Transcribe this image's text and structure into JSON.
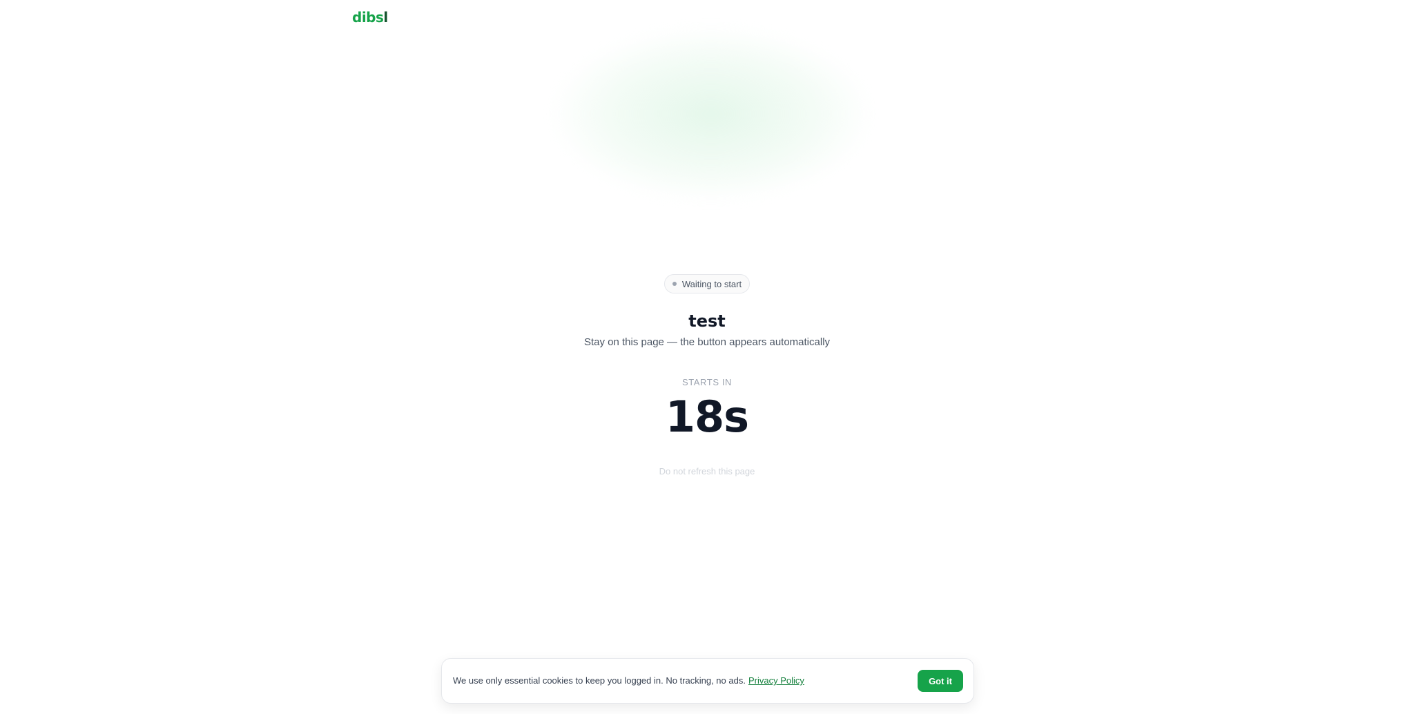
{
  "header": {
    "logo_main": "dibs",
    "logo_tail": "l"
  },
  "status": {
    "label": "Waiting to start"
  },
  "event": {
    "title": "test",
    "subtitle": "Stay on this page — the button appears automatically"
  },
  "countdown": {
    "label": "STARTS IN",
    "value": "18s",
    "note": "Do not refresh this page"
  },
  "cookie_banner": {
    "text": "We use only essential cookies to keep you logged in. No tracking, no ads.",
    "link_label": "Privacy Policy",
    "button_label": "Got it"
  },
  "colors": {
    "brand": "#16a34a",
    "brand_dark": "#14532d",
    "text": "#111827"
  }
}
